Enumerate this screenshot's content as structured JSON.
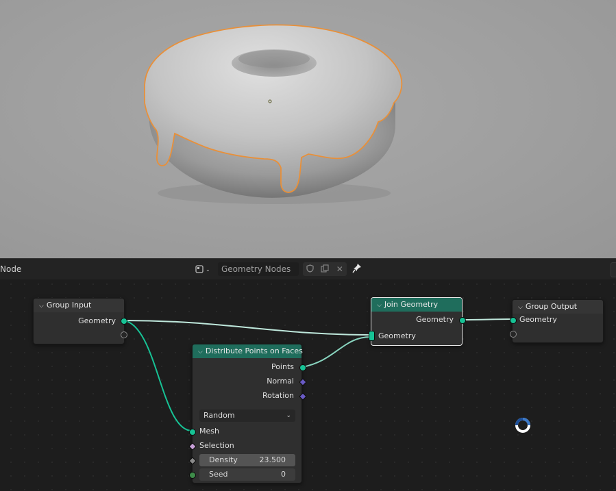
{
  "header": {
    "editor_label": "Node",
    "tree_name": "Geometry Nodes"
  },
  "nodes": {
    "group_input": {
      "title": "Group Input",
      "outputs": [
        "Geometry"
      ]
    },
    "join_geometry": {
      "title": "Join Geometry",
      "outputs": [
        "Geometry"
      ],
      "inputs": [
        "Geometry"
      ]
    },
    "group_output": {
      "title": "Group Output",
      "inputs": [
        "Geometry"
      ]
    },
    "distribute_points": {
      "title": "Distribute Points on Faces",
      "outputs": [
        "Points",
        "Normal",
        "Rotation"
      ],
      "mode": "Random",
      "inputs": {
        "mesh": "Mesh",
        "selection": "Selection",
        "density_label": "Density",
        "density_value": "23.500",
        "seed_label": "Seed",
        "seed_value": "0"
      }
    }
  },
  "colors": {
    "geometry_socket": "#17c295",
    "vector_socket": "#6a5bc4",
    "geometry_node_header": "#1f6d5c",
    "selection_outline": "#e8903a",
    "viewport_bg": "#a3a3a3"
  },
  "icons": [
    "editor-type-icon",
    "shield-icon",
    "duplicate-icon",
    "close-icon",
    "pin-icon",
    "chevron-down-icon",
    "loading-cursor-icon"
  ]
}
